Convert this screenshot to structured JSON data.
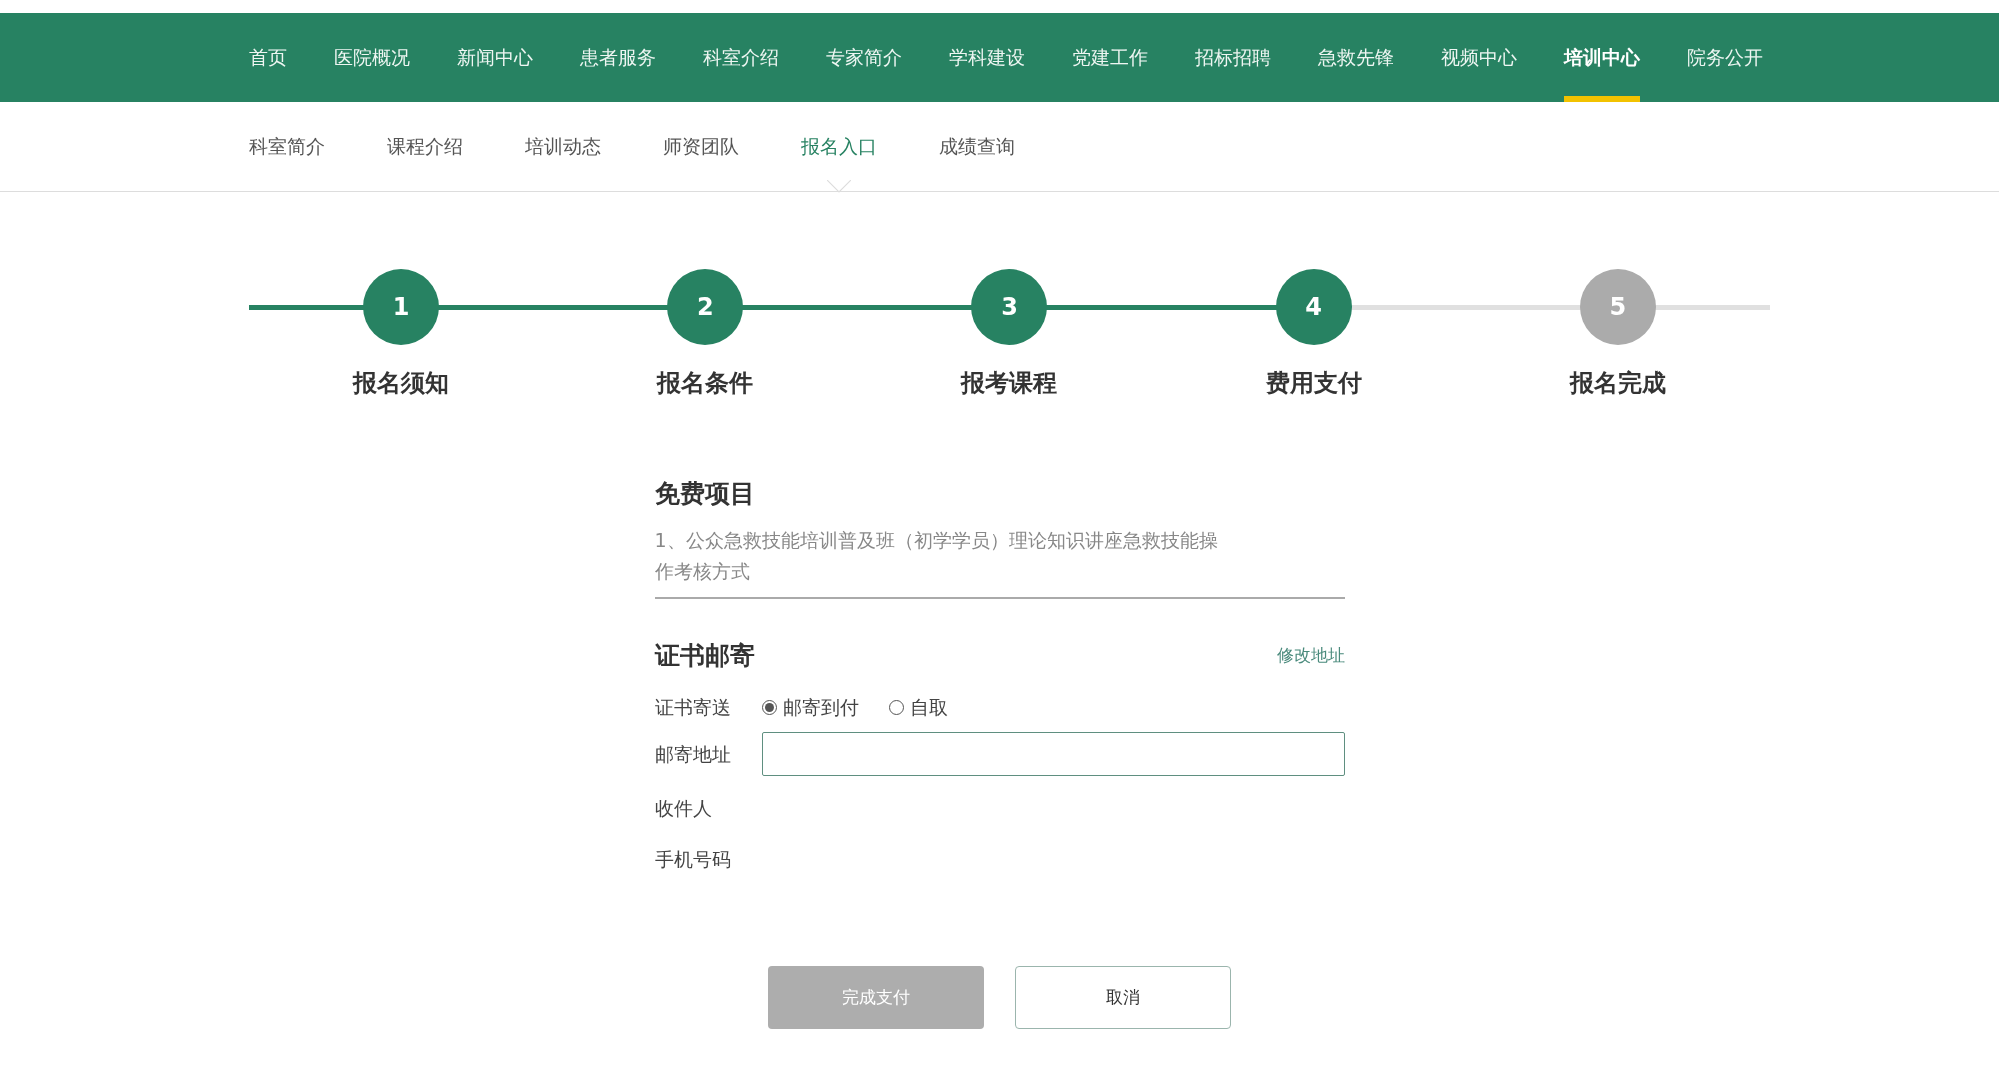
{
  "main_nav": [
    {
      "label": "首页",
      "selected": false
    },
    {
      "label": "医院概况",
      "selected": false
    },
    {
      "label": "新闻中心",
      "selected": false
    },
    {
      "label": "患者服务",
      "selected": false
    },
    {
      "label": "科室介绍",
      "selected": false
    },
    {
      "label": "专家简介",
      "selected": false
    },
    {
      "label": "学科建设",
      "selected": false
    },
    {
      "label": "党建工作",
      "selected": false
    },
    {
      "label": "招标招聘",
      "selected": false
    },
    {
      "label": "急救先锋",
      "selected": false
    },
    {
      "label": "视频中心",
      "selected": false
    },
    {
      "label": "培训中心",
      "selected": true
    },
    {
      "label": "院务公开",
      "selected": false
    }
  ],
  "sub_nav": [
    {
      "label": "科室简介",
      "selected": false
    },
    {
      "label": "课程介绍",
      "selected": false
    },
    {
      "label": "培训动态",
      "selected": false
    },
    {
      "label": "师资团队",
      "selected": false
    },
    {
      "label": "报名入口",
      "selected": true
    },
    {
      "label": "成绩查询",
      "selected": false
    }
  ],
  "steps": [
    {
      "number": "1",
      "label": "报名须知",
      "completed": true
    },
    {
      "number": "2",
      "label": "报名条件",
      "completed": true
    },
    {
      "number": "3",
      "label": "报考课程",
      "completed": true
    },
    {
      "number": "4",
      "label": "费用支付",
      "completed": true
    },
    {
      "number": "5",
      "label": "报名完成",
      "completed": false
    }
  ],
  "free_items": {
    "title": "免费项目",
    "text": "1、公众急救技能培训普及班（初学学员）理论知识讲座急救技能操作考核方式"
  },
  "certificate_mailing": {
    "title": "证书邮寄",
    "edit_link": "修改地址",
    "delivery_label": "证书寄送",
    "delivery_options": [
      {
        "label": "邮寄到付",
        "selected": true
      },
      {
        "label": "自取",
        "selected": false
      }
    ],
    "address_label": "邮寄地址",
    "recipient_label": "收件人",
    "phone_label": "手机号码"
  },
  "buttons": [
    {
      "label": "完成支付",
      "disabled": true
    },
    {
      "label": "取消",
      "disabled": false
    }
  ]
}
